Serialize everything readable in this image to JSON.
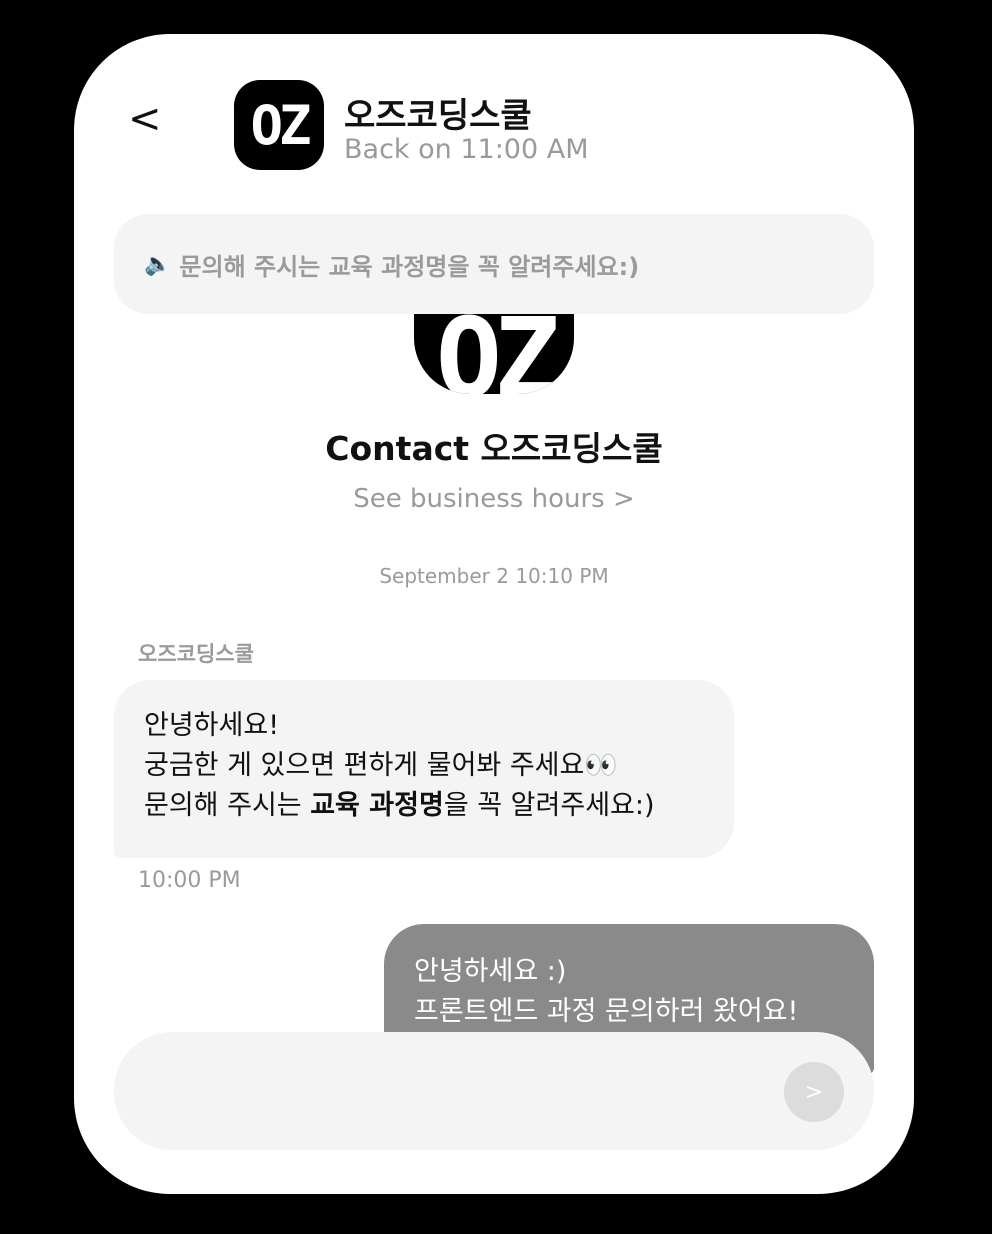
{
  "header": {
    "back_label": "<",
    "logo_text": "OZ",
    "title": "오즈코딩스쿨",
    "status": "Back on 11:00 AM"
  },
  "notice": {
    "icon": "speaker-icon",
    "icon_glyph": "🔈",
    "text": "문의해 주시는 교육 과정명을 꼭 알려주세요:)"
  },
  "profile": {
    "logo_text": "OZ",
    "contact_label": "Contact 오즈코딩스쿨",
    "hours_link": "See business hours >"
  },
  "conversation": {
    "date": "September 2 10:10 PM",
    "incoming": {
      "sender": "오즈코딩스쿨",
      "line1": "안녕하세요!",
      "line2": "궁금한 게 있으면 편하게 물어봐 주세요👀",
      "line3_prefix": "문의해 주시는 ",
      "line3_bold": "교육 과정명",
      "line3_suffix": "을 꼭 알려주세요:)",
      "time": "10:00 PM"
    },
    "outgoing": {
      "line1": "안녕하세요 :)",
      "line2": "프론트엔드 과정 문의하러 왔어요!"
    }
  },
  "composer": {
    "placeholder": "",
    "send_label": ">"
  },
  "colors": {
    "background": "#000000",
    "panel": "#ffffff",
    "bubble_in": "#f4f4f4",
    "bubble_out": "#8a8a8a",
    "muted_text": "#9a9a9a"
  }
}
